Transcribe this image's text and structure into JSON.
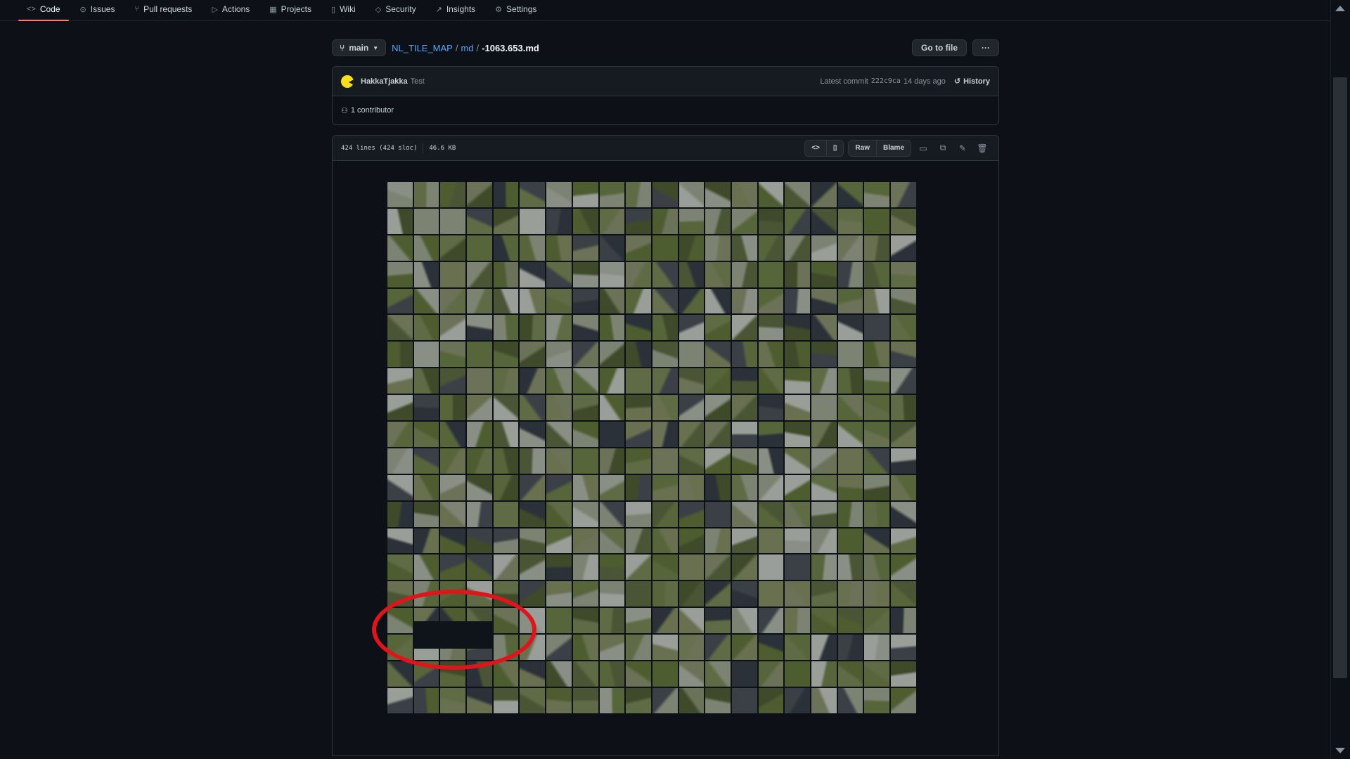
{
  "nav": {
    "items": [
      {
        "label": "Code",
        "icon": "code-icon"
      },
      {
        "label": "Issues",
        "icon": "issue-icon"
      },
      {
        "label": "Pull requests",
        "icon": "pull-request-icon"
      },
      {
        "label": "Actions",
        "icon": "play-icon"
      },
      {
        "label": "Projects",
        "icon": "table-icon"
      },
      {
        "label": "Wiki",
        "icon": "book-icon"
      },
      {
        "label": "Security",
        "icon": "shield-icon"
      },
      {
        "label": "Insights",
        "icon": "graph-icon"
      },
      {
        "label": "Settings",
        "icon": "gear-icon"
      }
    ],
    "active": "Code"
  },
  "path": {
    "branch": "main",
    "repo": "NL_TILE_MAP",
    "folder": "md",
    "file": "-1063.653.md",
    "go_to_file": "Go to file",
    "more": "···"
  },
  "commit": {
    "author": "HakkaTjakka",
    "message": "Test",
    "latest_label": "Latest commit",
    "sha": "222c9ca",
    "time": "14 days ago",
    "history": "History",
    "contributors": "1 contributor"
  },
  "file": {
    "lines": "424 lines (424 sloc)",
    "size": "46.6 KB",
    "raw": "Raw",
    "blame": "Blame"
  },
  "map": {
    "rows": 20,
    "cols": 20,
    "highlight_color": "#e0151c"
  },
  "colors": {
    "background": "#0d1117",
    "link": "#58a6ff",
    "nav_underline": "#f78166"
  }
}
